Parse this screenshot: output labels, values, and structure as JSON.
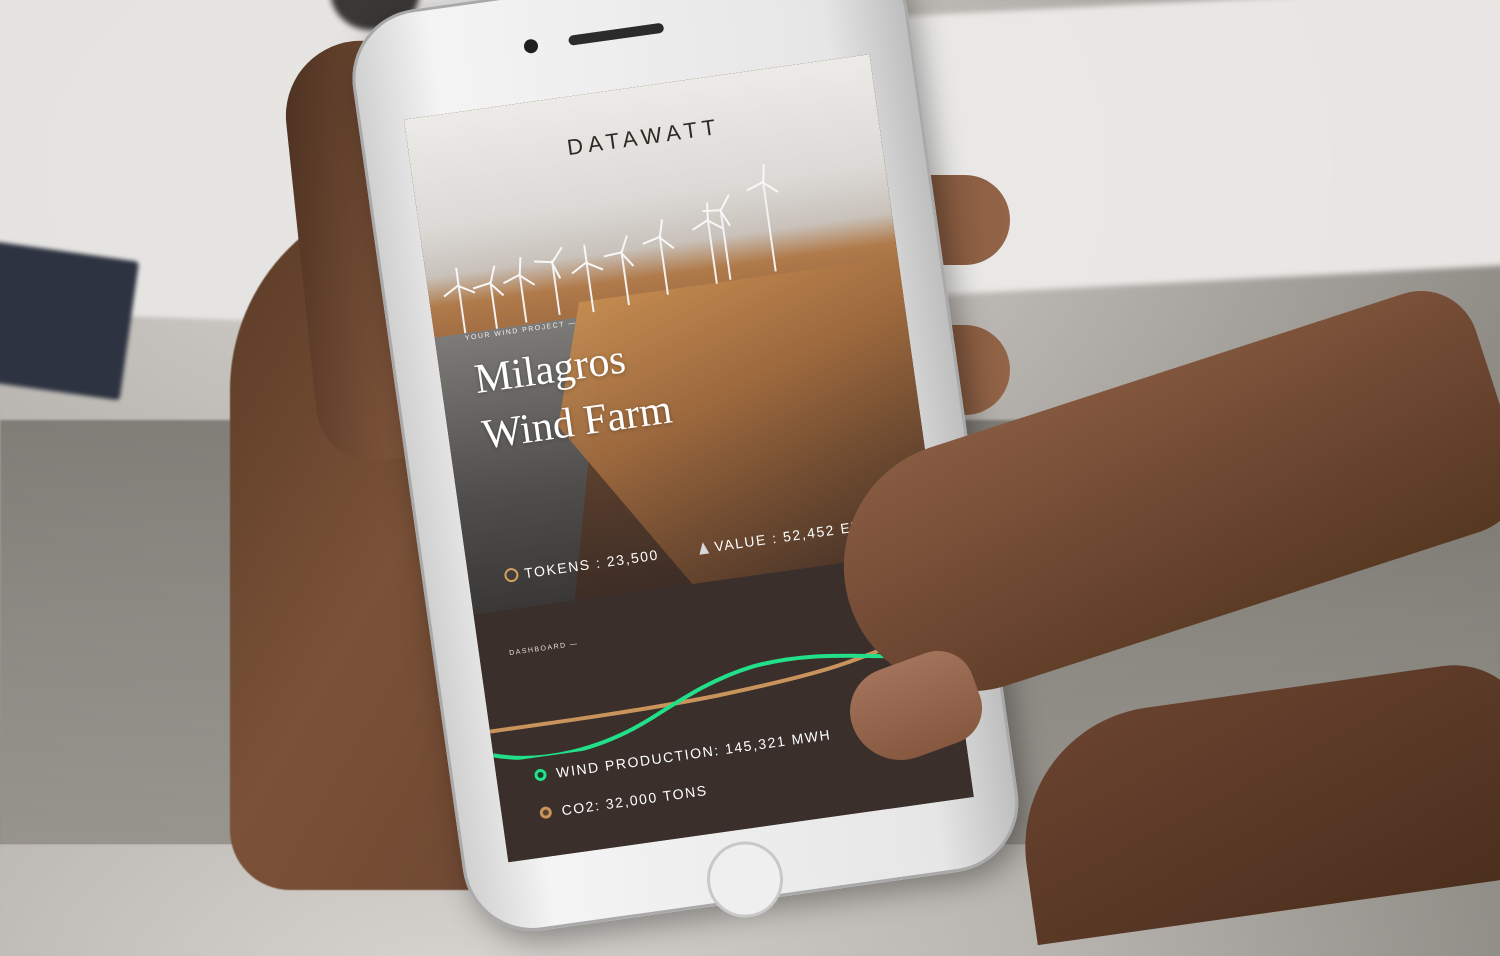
{
  "app": {
    "brand": "DATAWATT"
  },
  "project": {
    "eyebrow": "YOUR WIND PROJECT —",
    "title_line1": "Milagros",
    "title_line2": "Wind Farm",
    "tokens": "TOKENS : 23,500",
    "value": "VALUE : 52,452 ETH"
  },
  "dashboard": {
    "label": "DASHBOARD —",
    "wind_production": "WIND PRODUCTION: 145,321 MWH",
    "co2": "CO2: 32,000 TONS"
  },
  "colors": {
    "wind_series": "#22e08a",
    "co2_series": "#c9935c",
    "dashboard_bg": "#3a2f2b"
  },
  "icons": {
    "tokens": "token-coin-icon",
    "value": "ethereum-icon",
    "wind_legend": "green-dot-icon",
    "co2_legend": "gold-dot-icon"
  }
}
